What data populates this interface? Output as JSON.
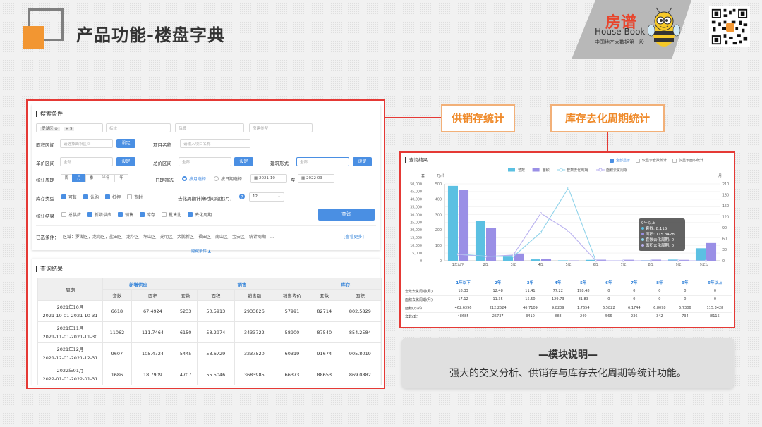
{
  "header": {
    "title": "产品功能-楼盘字典"
  },
  "brand": {
    "cn": "房谱",
    "en": "House-Book",
    "sub": "中国地产大数据第一股"
  },
  "callouts": {
    "supply": "供销存统计",
    "cycle": "库存去化周期统计"
  },
  "search": {
    "heading": "搜索条件",
    "district_tag": "罗湖区 ⊗",
    "district_more": "+ 9",
    "block_placeholder": "板块",
    "brand_placeholder": "品牌",
    "type_placeholder": "房建类型",
    "area_label": "面积区间",
    "area_placeholder": "请选择面积区间",
    "set": "设定",
    "project_label": "项目名称",
    "project_placeholder": "请输入项目名称",
    "unit_label": "单价区间",
    "all": "全部",
    "total_label": "总价区间",
    "form_label": "建筑形式",
    "period_label": "统计周期",
    "period_opts": [
      "周",
      "月",
      "季",
      "半年",
      "年"
    ],
    "period_active": 1,
    "date_label": "日期筛选",
    "by_month": "按月选择",
    "by_day": "按日期选择",
    "date_from": "2021-10",
    "date_to": "2022-03",
    "date_sep": "至",
    "stock_label": "库存类型",
    "stock_opts": [
      "可售",
      "认购",
      "抵押",
      "查封"
    ],
    "cycle_label": "去化周期计算时间跨度(月)",
    "cycle_value": "12",
    "result_label": "统计结果",
    "result_opts": [
      "总供应",
      "新增供应",
      "销售",
      "库存",
      "批售比",
      "去化周期"
    ],
    "query": "查询",
    "selected_label": "已选条件：",
    "selected_text": "区域：罗湖区，龙岗区，盐田区，龙华区，坪山区，光明区，大鹏新区，福田区，南山区，宝安区；统计周期：...",
    "see_more": "[查看更多]",
    "collapse": "隐藏条件 ▲"
  },
  "result": {
    "heading": "查询结果",
    "col_period": "周期",
    "groups": [
      "新增供应",
      "销售",
      "库存"
    ],
    "subcols": [
      "套数",
      "面积",
      "套数",
      "面积",
      "销售额",
      "销售均价",
      "套数",
      "面积"
    ],
    "rows": [
      {
        "p1": "2021年10月",
        "p2": "2021-10-01-2021-10-31",
        "v": [
          "6618",
          "67.4924",
          "5233",
          "50.5913",
          "2933826",
          "57991",
          "82714",
          "802.5829"
        ]
      },
      {
        "p1": "2021年11月",
        "p2": "2021-11-01-2021-11-30",
        "v": [
          "11062",
          "111.7464",
          "6150",
          "58.2974",
          "3433722",
          "58900",
          "87540",
          "854.2584"
        ]
      },
      {
        "p1": "2021年12月",
        "p2": "2021-12-01-2021-12-31",
        "v": [
          "9607",
          "105.4724",
          "5445",
          "53.6729",
          "3237520",
          "60319",
          "91674",
          "905.8019"
        ]
      },
      {
        "p1": "2022年01月",
        "p2": "2022-01-01-2022-01-31",
        "v": [
          "1686",
          "18.7909",
          "4707",
          "55.5046",
          "3683985",
          "66373",
          "88653",
          "869.0882"
        ]
      }
    ]
  },
  "panel2": {
    "heading": "查询结果",
    "opts": [
      "全部显示",
      "仅显示套数统计",
      "仅显示面积统计"
    ],
    "unit_left_a": "套",
    "unit_left_b": "万㎡",
    "unit_right": "月"
  },
  "chart_data": {
    "type": "bar",
    "categories": [
      "1年以下",
      "2年",
      "3年",
      "4年",
      "5年",
      "6年",
      "7年",
      "8年",
      "9年",
      "9年以上"
    ],
    "series": [
      {
        "name": "套数",
        "values": [
          48685,
          25737,
          3410,
          888,
          249,
          566,
          236,
          342,
          734,
          8115
        ],
        "color": "#5bc0e2",
        "axis": "left"
      },
      {
        "name": "面积",
        "values": [
          462.6396,
          212.2524,
          46.7109,
          9.8209,
          1.7654,
          6.5822,
          6.1744,
          6.8098,
          5.7306,
          115.3428
        ],
        "color": "#9a8fe6",
        "axis": "mid"
      },
      {
        "name": "套数去化周期",
        "values": [
          18.33,
          12.48,
          11.41,
          77.22,
          198.48,
          0,
          0,
          0,
          0,
          0
        ],
        "color": "#8fd3ea",
        "axis": "right"
      },
      {
        "name": "面积去化周期",
        "values": [
          17.12,
          11.35,
          15.5,
          129.73,
          81.83,
          0,
          0,
          0,
          0,
          0
        ],
        "color": "#b9b1ef",
        "axis": "right"
      }
    ],
    "y_left_ticks": [
      "0",
      "5,000",
      "10,000",
      "15,000",
      "20,000",
      "25,000",
      "30,000",
      "35,000",
      "40,000",
      "45,000",
      "50,000"
    ],
    "y_mid_ticks": [
      "0",
      "100",
      "200",
      "300",
      "400",
      "500"
    ],
    "y_right_ticks": [
      "0",
      "30",
      "60",
      "90",
      "120",
      "150",
      "180",
      "210"
    ],
    "ylim_left": [
      0,
      50000
    ],
    "ylim_mid": [
      0,
      500
    ],
    "ylim_right": [
      0,
      210
    ],
    "legend": "top-center",
    "tooltip": {
      "title": "9年以上",
      "lines": [
        "套数: 8,115",
        "面积: 115.3428",
        "套数去化周期: 0",
        "面积去化周期: 0"
      ]
    }
  },
  "stat_table": {
    "header": [
      "1年以下",
      "2年",
      "3年",
      "4年",
      "5年",
      "6年",
      "7年",
      "8年",
      "9年",
      "9年以上"
    ],
    "rows": [
      {
        "label": "套数去化周期(月)",
        "values": [
          "18.33",
          "12.48",
          "11.41",
          "77.22",
          "198.48",
          "0",
          "0",
          "0",
          "0",
          "0"
        ]
      },
      {
        "label": "面积去化周期(月)",
        "values": [
          "17.12",
          "11.35",
          "15.50",
          "129.73",
          "81.83",
          "0",
          "0",
          "0",
          "0",
          "0"
        ]
      },
      {
        "label": "面积(万㎡)",
        "values": [
          "462.6396",
          "212.2524",
          "46.7109",
          "9.8209",
          "1.7654",
          "6.5822",
          "6.1744",
          "6.8098",
          "5.7306",
          "115.3428"
        ]
      },
      {
        "label": "套数(套)",
        "values": [
          "48685",
          "25737",
          "3410",
          "888",
          "249",
          "566",
          "236",
          "342",
          "734",
          "8115"
        ]
      }
    ]
  },
  "module": {
    "title": "—模块说明—",
    "text": "强大的交叉分析、供销存与库存去化周期等统计功能。"
  }
}
